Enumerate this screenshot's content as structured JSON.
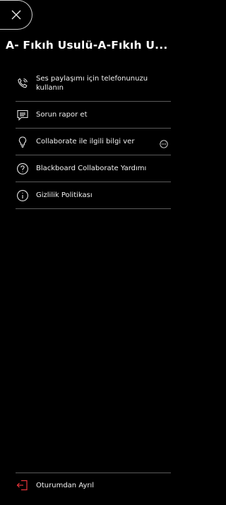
{
  "header": {
    "close_icon": "close-icon",
    "title": "A- Fıkıh Usulü-A-Fıkıh U..."
  },
  "menu": {
    "items": [
      {
        "label": "Ses paylaşımı için telefonunuzu kullanın",
        "icon": "phone-icon"
      },
      {
        "label": "Sorun rapor et",
        "icon": "report-icon"
      },
      {
        "label": "Collaborate ile ilgili bilgi ver",
        "icon": "lightbulb-icon",
        "trailing_icon": "more-options-icon"
      },
      {
        "label": "Blackboard Collaborate Yardımı",
        "icon": "help-icon"
      },
      {
        "label": "Gizlilik Politikası",
        "icon": "info-icon"
      }
    ]
  },
  "footer": {
    "leave_label": "Oturumdan Ayrıl",
    "leave_icon": "exit-icon",
    "leave_icon_color": "#e8343a"
  }
}
